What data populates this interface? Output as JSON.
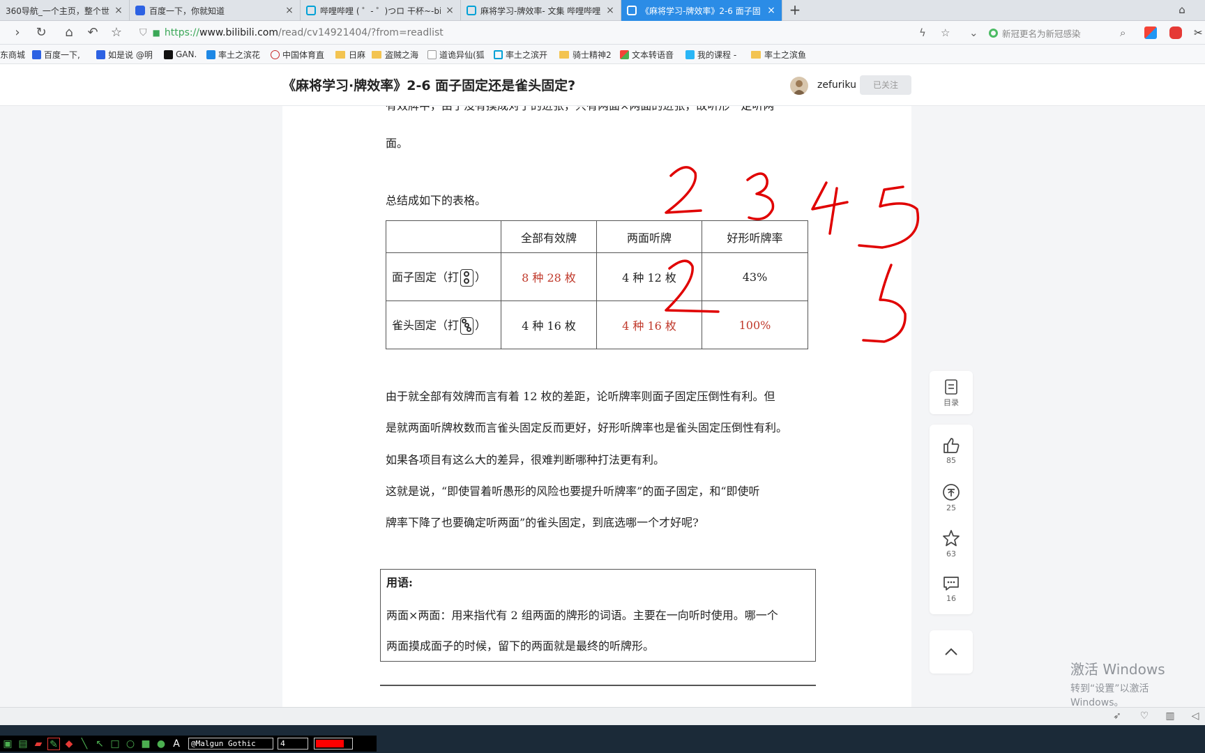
{
  "browser": {
    "tabs": [
      {
        "title": "360导航_一个主页，整个世界",
        "icon_color": "#3aa1ff",
        "active": false
      },
      {
        "title": "百度一下，你就知道",
        "icon_color": "#2d62e3",
        "active": false
      },
      {
        "title": "哔哩哔哩 ( ゜- ゜)つロ 干杯~-bil",
        "icon_color": "#00a1d6",
        "active": false
      },
      {
        "title": "麻将学习-牌效率- 文集 哔哩哔哩",
        "icon_color": "#00a1d6",
        "active": false
      },
      {
        "title": "《麻将学习-牌效率》2-6 面子固",
        "icon_color": "#ffffff",
        "active": true
      }
    ],
    "new_tab_label": "+",
    "url": {
      "scheme": "https://",
      "host": "www.bilibili.com",
      "path": "/read/cv14921404/?from=readlist"
    },
    "search_placeholder": "新冠更名为新冠感染",
    "bookmarks": [
      {
        "label": "东商城",
        "kind": "site",
        "color": "#e33"
      },
      {
        "label": "百度一下,",
        "kind": "site",
        "color": "#2d62e3"
      },
      {
        "label": "如是说 @明",
        "kind": "site",
        "color": "#2d62e3"
      },
      {
        "label": "GAN.",
        "kind": "site",
        "color": "#111"
      },
      {
        "label": "率土之滨花",
        "kind": "site",
        "color": "#1e88e5"
      },
      {
        "label": "中国体育直",
        "kind": "site",
        "color": "#c62828"
      },
      {
        "label": "日麻",
        "kind": "folder",
        "color": "#f3c451"
      },
      {
        "label": "盗贼之海",
        "kind": "folder",
        "color": "#f3c451"
      },
      {
        "label": "道诡异仙(狐",
        "kind": "page",
        "color": "#999"
      },
      {
        "label": "率土之滨开",
        "kind": "site",
        "color": "#00a1d6"
      },
      {
        "label": "骑士精神2",
        "kind": "folder",
        "color": "#f3c451"
      },
      {
        "label": "文本转语音",
        "kind": "site",
        "color": "#2e7d32"
      },
      {
        "label": "我的课程 -",
        "kind": "site",
        "color": "#29b6f6"
      },
      {
        "label": "率土之滨鱼",
        "kind": "folder",
        "color": "#f3c451"
      }
    ]
  },
  "article": {
    "title": "《麻将学习·牌效率》2-6 面子固定还是雀头固定?",
    "author": "zefuriku",
    "follow_label": "已关注",
    "para_cut": "有效牌中，由于没有摸成对子的进张，只有两面×两面的进张，故听形一定听两",
    "para_cut_end": "面。",
    "summary": "总结成如下的表格。",
    "table": {
      "headers": [
        "",
        "全部有效牌",
        "两面听牌",
        "好形听牌率"
      ],
      "rows": [
        {
          "label_prefix": "面子固定（打",
          "label_suffix": "）",
          "tile": "two-pin",
          "cells": [
            "8 种 28 枚",
            "4 种 12 枚",
            "43%"
          ],
          "red": [
            true,
            false,
            false
          ]
        },
        {
          "label_prefix": "雀头固定（打",
          "label_suffix": "）",
          "tile": "three-pin",
          "cells": [
            "4 种 16 枚",
            "4 种 16 枚",
            "100%"
          ],
          "red": [
            false,
            true,
            true
          ]
        }
      ]
    },
    "paragraphs": [
      "由于就全部有效牌而言有着 12 枚的差距，论听牌率则面子固定压倒性有利。但",
      "是就两面听牌枚数而言雀头固定反而更好，好形听牌率也是雀头固定压倒性有利。",
      "如果各项目有这么大的差异，很难判断哪种打法更有利。",
      "这就是说，“即使冒着听愚形的风险也要提升听牌率”的面子固定，和“即使听",
      "牌率下降了也要确定听两面”的雀头固定，到底选哪一个才好呢?"
    ],
    "glossary": {
      "title": "用语:",
      "lines": [
        "两面×两面：用来指代有 2 组两面的牌形的词语。主要在一向听时使用。哪一个",
        "两面摸成面子的时候，留下的两面就是最终的听牌形。"
      ]
    }
  },
  "sidebar": {
    "toc_label": "目录",
    "like_count": "85",
    "coin_count": "25",
    "fav_count": "63",
    "comment_count": "16"
  },
  "watermark": {
    "line1": "激活 Windows",
    "line2": "转到“设置”以激活 Windows。"
  },
  "pen_toolbar": {
    "font": "@Malgun Gothic",
    "size": "4",
    "color": "#ff0000"
  },
  "annotations": {
    "ink_color": "#e00000",
    "handwritten": [
      "2",
      "3",
      "4",
      "5",
      "2",
      "5"
    ]
  }
}
